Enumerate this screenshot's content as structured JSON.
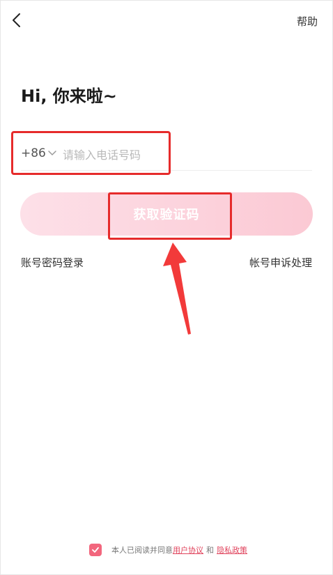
{
  "header": {
    "help_label": "帮助"
  },
  "main": {
    "title": "Hi, 你来啦~",
    "phone": {
      "country_code": "+86",
      "placeholder": "请输入电话号码",
      "value": ""
    },
    "get_code_label": "获取验证码",
    "password_login_label": "账号密码登录",
    "appeal_label": "帐号申诉处理"
  },
  "footer": {
    "agreement_prefix": "本人已阅读并同意",
    "user_agreement": "用户协议",
    "and_text": "和",
    "privacy_policy": "隐私政策",
    "agreed": true
  },
  "colors": {
    "accent": "#e0445d",
    "button_gradient_start": "#fde0e8",
    "button_gradient_end": "#fbc9d4",
    "annotation": "#e62b2b"
  },
  "icons": {
    "back": "chevron-left-icon",
    "country_dropdown": "chevron-down-icon",
    "checkbox": "check-icon",
    "annotation_arrow": "arrow-up-icon"
  }
}
